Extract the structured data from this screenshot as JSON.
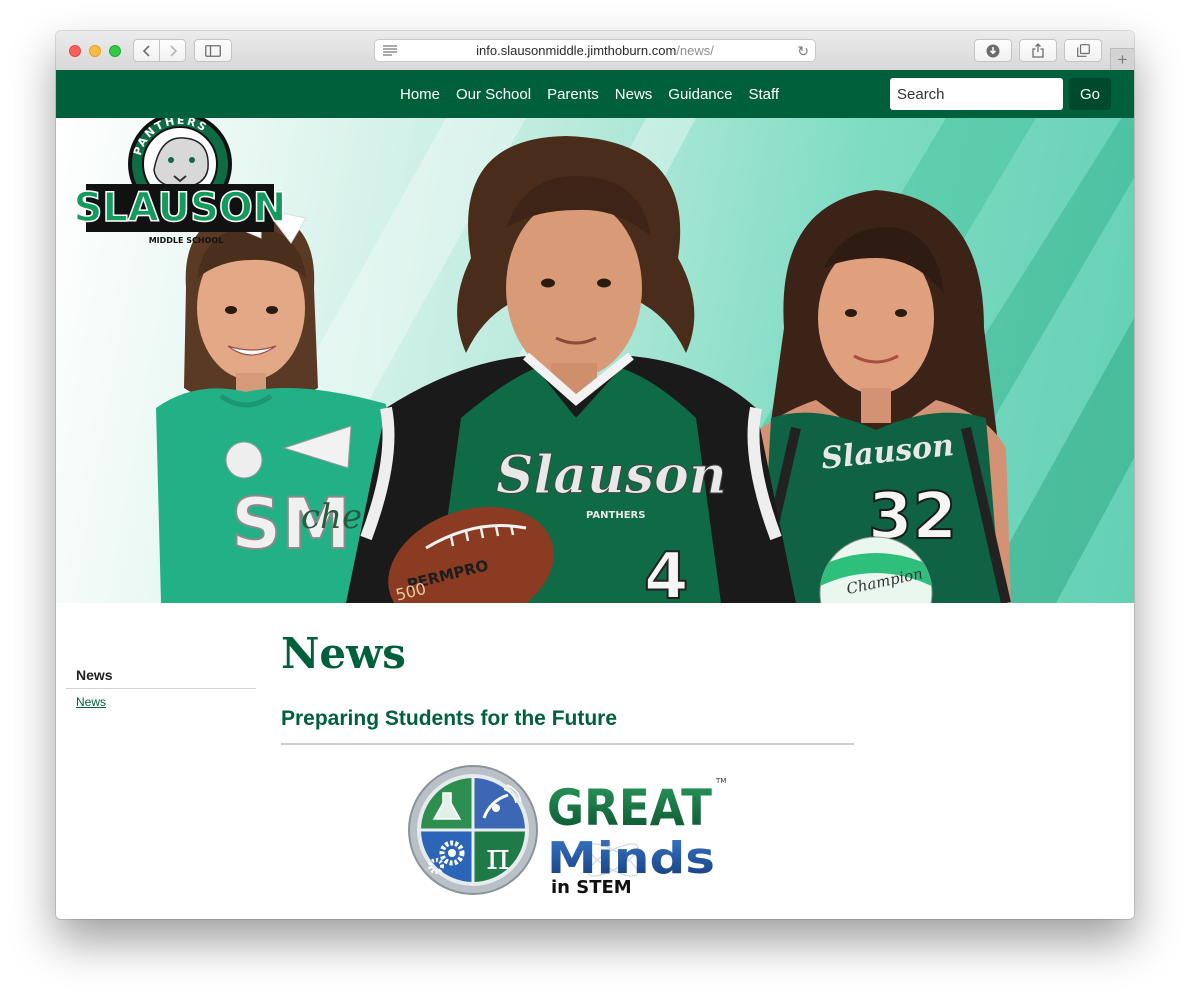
{
  "browser": {
    "url_host": "info.slausonmiddle.jimthoburn.com",
    "url_path": "/news/"
  },
  "nav": {
    "items": [
      "Home",
      "Our School",
      "Parents",
      "News",
      "Guidance",
      "Staff"
    ],
    "search_placeholder": "Search",
    "go_label": "Go"
  },
  "logo": {
    "top_text": "PANTHERS",
    "main_text": "SLAUSON",
    "sub_text": "MIDDLE SCHOOL"
  },
  "hero": {
    "jersey_script": "Slauson",
    "jersey_sub": "PANTHERS",
    "jersey_number_center": "4",
    "jersey_number_right": "32",
    "shirt_text": "SM",
    "shirt_cheer": "cheer",
    "football_text": "PERMPRO",
    "football_number": "500",
    "volleyball_text": "Champion"
  },
  "sidebar": {
    "title": "News",
    "link": "News"
  },
  "main": {
    "title": "News",
    "subheading": "Preparing Students for the Future"
  },
  "stem_logo": {
    "line1": "GREAT",
    "line2": "Minds",
    "line3": "in STEM",
    "tm": "TM",
    "pi": "π"
  },
  "colors": {
    "brand_green": "#00603b",
    "go_button": "#004a2c"
  }
}
